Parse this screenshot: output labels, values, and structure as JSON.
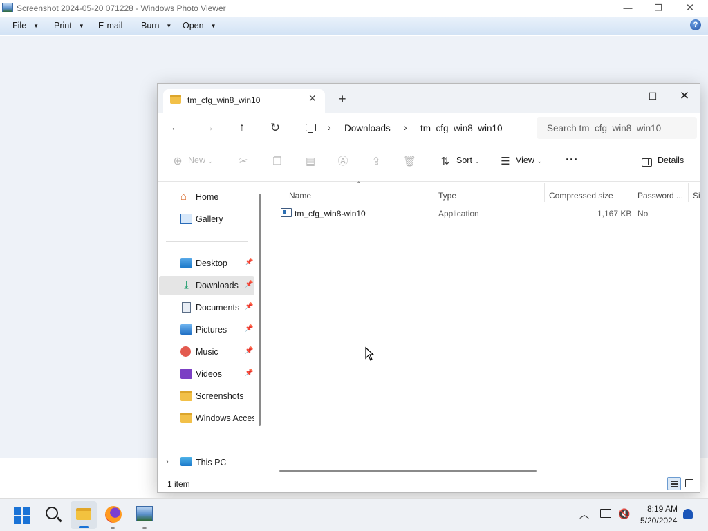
{
  "photo_viewer": {
    "title": "Screenshot 2024-05-20 071228 - Windows Photo Viewer",
    "menu": [
      "File",
      "Print",
      "E-mail",
      "Burn",
      "Open"
    ],
    "help": "?"
  },
  "explorer": {
    "tab_title": "tm_cfg_win8_win10",
    "search_placeholder": "Search tm_cfg_win8_win10",
    "breadcrumb": [
      "Downloads",
      "tm_cfg_win8_win10"
    ],
    "toolbar": {
      "new": "New",
      "sort": "Sort",
      "view": "View",
      "more": "···",
      "details": "Details"
    },
    "nav": {
      "home": "Home",
      "gallery": "Gallery",
      "desktop": "Desktop",
      "downloads": "Downloads",
      "documents": "Documents",
      "pictures": "Pictures",
      "music": "Music",
      "videos": "Videos",
      "screenshots": "Screenshots",
      "windows_accessories": "Windows Accessories",
      "this_pc": "This PC"
    },
    "columns": [
      "Name",
      "Type",
      "Compressed size",
      "Password ...",
      "Si"
    ],
    "files": [
      {
        "name": "tm_cfg_win8-win10",
        "type": "Application",
        "compressed_size": "1,167 KB",
        "password": "No"
      }
    ],
    "status": "1 item"
  },
  "taskbar": {
    "time": "8:19 AM",
    "date": "5/20/2024"
  }
}
